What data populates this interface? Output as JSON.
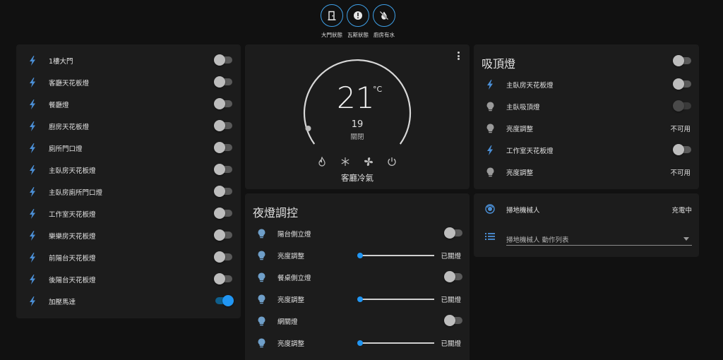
{
  "badges": [
    {
      "label": "大門狀態",
      "icon": "door-icon"
    },
    {
      "label": "瓦斯狀態",
      "icon": "alert-icon"
    },
    {
      "label": "廚房有水",
      "icon": "water-off-icon"
    }
  ],
  "switch_list": {
    "items": [
      {
        "label": "1樓大門",
        "on": false
      },
      {
        "label": "客廳天花板燈",
        "on": false
      },
      {
        "label": "餐廳燈",
        "on": false
      },
      {
        "label": "廚房天花板燈",
        "on": false
      },
      {
        "label": "廁所門口燈",
        "on": false
      },
      {
        "label": "主臥房天花板燈",
        "on": false
      },
      {
        "label": "主臥房廁所門口燈",
        "on": false
      },
      {
        "label": "工作室天花板燈",
        "on": false
      },
      {
        "label": "樂樂房天花板燈",
        "on": false
      },
      {
        "label": "前陽台天花板燈",
        "on": false
      },
      {
        "label": "後陽台天花板燈",
        "on": false
      },
      {
        "label": "加壓馬達",
        "on": true
      }
    ]
  },
  "thermostat": {
    "temperature": "21",
    "unit": "°C",
    "target": "19",
    "mode": "關閉",
    "name": "客廳冷氣",
    "level": 0.0
  },
  "ceiling_lights": {
    "title": "吸頂燈",
    "items": [
      {
        "label": "主臥房天花板燈",
        "icon": "bolt-icon",
        "kind": "toggle",
        "state": "off"
      },
      {
        "label": "主臥吸頂燈",
        "icon": "bulb-icon",
        "kind": "toggle",
        "state": "disabled"
      },
      {
        "label": "亮度調整",
        "icon": "bulb-icon",
        "kind": "text",
        "state": "不可用"
      },
      {
        "label": "工作室天花板燈",
        "icon": "bolt-icon",
        "kind": "toggle",
        "state": "off"
      },
      {
        "label": "亮度調整",
        "icon": "bulb-icon",
        "kind": "text",
        "state": "不可用"
      }
    ]
  },
  "night_lights": {
    "title": "夜燈調控",
    "items": [
      {
        "label": "陽台側立燈",
        "kind": "toggle"
      },
      {
        "label": "亮度調整",
        "kind": "slider",
        "state": "已關燈",
        "level": 0.0
      },
      {
        "label": "餐桌側立燈",
        "kind": "toggle"
      },
      {
        "label": "亮度調整",
        "kind": "slider",
        "state": "已關燈",
        "level": 0.0
      },
      {
        "label": "網關燈",
        "kind": "toggle"
      },
      {
        "label": "亮度調整",
        "kind": "slider",
        "state": "已關燈",
        "level": 0.0
      }
    ]
  },
  "vacuum": {
    "name": "掃地機械人",
    "status": "充電中",
    "select_label": "掃地機械人 動作列表"
  },
  "colors": {
    "accent": "#2196f3",
    "icon": "#4b8fd6"
  }
}
